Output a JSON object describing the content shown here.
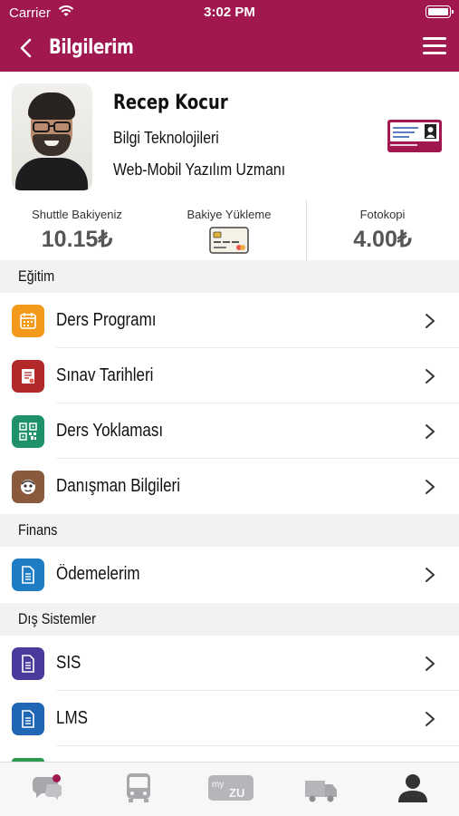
{
  "status_bar": {
    "carrier": "Carrier",
    "time": "3:02 PM"
  },
  "header": {
    "title": "Bilgilerim",
    "back_icon": "chevron-left-icon",
    "menu_icon": "hamburger-menu-icon",
    "color": "#a1174f"
  },
  "profile": {
    "name": "Recep Kocur",
    "department": "Bilgi Teknolojileri",
    "role": "Web-Mobil Yazılım Uzmanı",
    "card_icon": "id-card-icon"
  },
  "stats": {
    "shuttle": {
      "label": "Shuttle Bakiyeniz",
      "value": "10.15₺"
    },
    "topup": {
      "label": "Bakiye Yükleme",
      "icon": "credit-card-icon"
    },
    "copy": {
      "label": "Fotokopi",
      "value": "4.00₺"
    }
  },
  "sections": [
    {
      "title": "Eğitim",
      "items": [
        {
          "label": "Ders Programı",
          "icon": "calendar-icon",
          "color": "#f39a1c"
        },
        {
          "label": "Sınav Tarihleri",
          "icon": "exam-document-icon",
          "color": "#b3292a"
        },
        {
          "label": "Ders Yoklaması",
          "icon": "qr-code-icon",
          "color": "#1f9168"
        },
        {
          "label": "Danışman Bilgileri",
          "icon": "advisor-face-icon",
          "color": "#8a5a3c"
        }
      ]
    },
    {
      "title": "Finans",
      "items": [
        {
          "label": "Ödemelerim",
          "icon": "document-icon",
          "color": "#1e7dc4"
        }
      ]
    },
    {
      "title": "Dış Sistemler",
      "items": [
        {
          "label": "SIS",
          "icon": "document-icon",
          "color": "#4b3a9c"
        },
        {
          "label": "LMS",
          "icon": "document-icon",
          "color": "#1f67b5"
        }
      ]
    }
  ],
  "tabbar": {
    "tabs": [
      {
        "icon": "chat-icon",
        "badge": true
      },
      {
        "icon": "bus-icon"
      },
      {
        "icon": "my-zu-icon",
        "text": "my ZU"
      },
      {
        "icon": "truck-icon"
      },
      {
        "icon": "profile-icon",
        "active": true
      }
    ]
  }
}
